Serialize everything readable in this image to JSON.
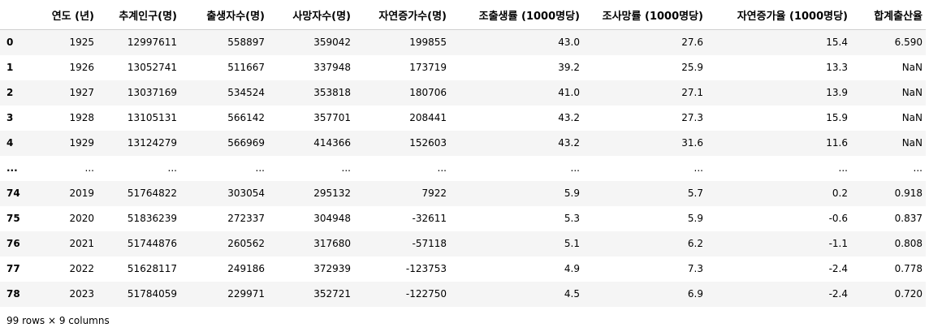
{
  "columns": [
    "연도 (년)",
    "추계인구(명)",
    "출생자수(명)",
    "사망자수(명)",
    "자연증가수(명)",
    "조출생률 (1000명당)",
    "조사망률 (1000명당)",
    "자연증가율 (1000명당)",
    "합계출산율"
  ],
  "rows": [
    {
      "index": "0",
      "cells": [
        "1925",
        "12997611",
        "558897",
        "359042",
        "199855",
        "43.0",
        "27.6",
        "15.4",
        "6.590"
      ]
    },
    {
      "index": "1",
      "cells": [
        "1926",
        "13052741",
        "511667",
        "337948",
        "173719",
        "39.2",
        "25.9",
        "13.3",
        "NaN"
      ]
    },
    {
      "index": "2",
      "cells": [
        "1927",
        "13037169",
        "534524",
        "353818",
        "180706",
        "41.0",
        "27.1",
        "13.9",
        "NaN"
      ]
    },
    {
      "index": "3",
      "cells": [
        "1928",
        "13105131",
        "566142",
        "357701",
        "208441",
        "43.2",
        "27.3",
        "15.9",
        "NaN"
      ]
    },
    {
      "index": "4",
      "cells": [
        "1929",
        "13124279",
        "566969",
        "414366",
        "152603",
        "43.2",
        "31.6",
        "11.6",
        "NaN"
      ]
    },
    {
      "index": "...",
      "cells": [
        "...",
        "...",
        "...",
        "...",
        "...",
        "...",
        "...",
        "...",
        "..."
      ]
    },
    {
      "index": "74",
      "cells": [
        "2019",
        "51764822",
        "303054",
        "295132",
        "7922",
        "5.9",
        "5.7",
        "0.2",
        "0.918"
      ]
    },
    {
      "index": "75",
      "cells": [
        "2020",
        "51836239",
        "272337",
        "304948",
        "-32611",
        "5.3",
        "5.9",
        "-0.6",
        "0.837"
      ]
    },
    {
      "index": "76",
      "cells": [
        "2021",
        "51744876",
        "260562",
        "317680",
        "-57118",
        "5.1",
        "6.2",
        "-1.1",
        "0.808"
      ]
    },
    {
      "index": "77",
      "cells": [
        "2022",
        "51628117",
        "249186",
        "372939",
        "-123753",
        "4.9",
        "7.3",
        "-2.4",
        "0.778"
      ]
    },
    {
      "index": "78",
      "cells": [
        "2023",
        "51784059",
        "229971",
        "352721",
        "-122750",
        "4.5",
        "6.9",
        "-2.4",
        "0.720"
      ]
    }
  ],
  "shape_text": "99 rows × 9 columns",
  "colors": {
    "row_stripe": "#f5f5f5",
    "header_border": "#d0d0d0",
    "text": "#000000"
  }
}
